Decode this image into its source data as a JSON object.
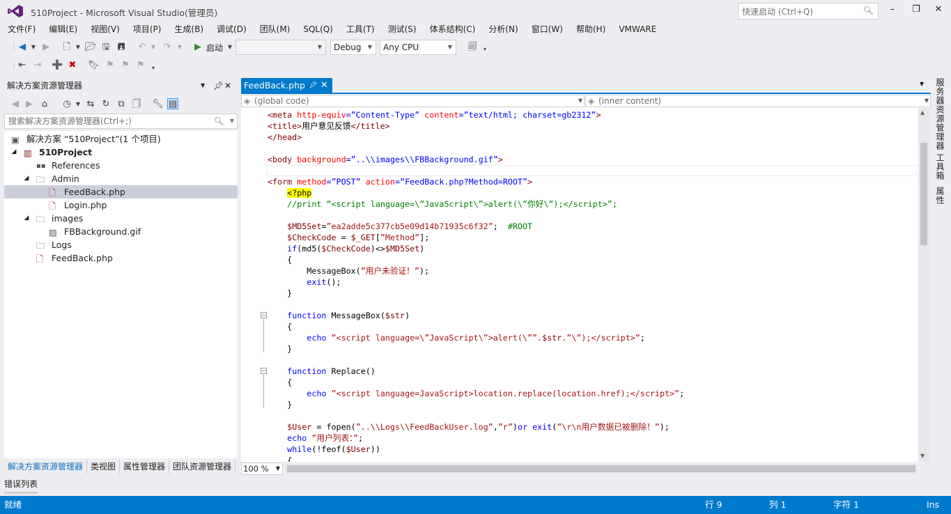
{
  "window": {
    "title": "510Project - Microsoft Visual Studio(管理员)",
    "quick_launch_placeholder": "快速启动 (Ctrl+Q)"
  },
  "menu": [
    "文件(F)",
    "编辑(E)",
    "视图(V)",
    "项目(P)",
    "生成(B)",
    "调试(D)",
    "团队(M)",
    "SQL(Q)",
    "工具(T)",
    "测试(S)",
    "体系结构(C)",
    "分析(N)",
    "窗口(W)",
    "帮助(H)",
    "VMWARE"
  ],
  "toolbar": {
    "start_label": "启动",
    "config": "Debug",
    "platform": "Any CPU"
  },
  "solution_explorer": {
    "title": "解决方案资源管理器",
    "search_placeholder": "搜索解决方案资源管理器(Ctrl+;)",
    "tree": [
      {
        "label": "解决方案 “510Project”(1 个项目)",
        "icon": "solution-icon"
      },
      {
        "label": "510Project",
        "icon": "php-project-icon"
      },
      {
        "label": "References",
        "icon": "references-icon"
      },
      {
        "label": "Admin",
        "icon": "folder-icon"
      },
      {
        "label": "FeedBack.php",
        "icon": "php-file-icon"
      },
      {
        "label": "Login.php",
        "icon": "php-file-icon"
      },
      {
        "label": "images",
        "icon": "folder-icon"
      },
      {
        "label": "FBBackground.gif",
        "icon": "image-file-icon"
      },
      {
        "label": "Logs",
        "icon": "folder-icon"
      },
      {
        "label": "FeedBack.php",
        "icon": "php-file-icon"
      }
    ],
    "bottom_tabs": [
      "解决方案资源管理器",
      "类视图",
      "属性管理器",
      "团队资源管理器"
    ]
  },
  "error_list_tab": "错误列表",
  "editor": {
    "tab_label": "FeedBack.php",
    "nav_left": "(global code)",
    "nav_right": "(inner content)",
    "zoom": "100 %"
  },
  "right_strip": [
    "服务器资源管理器",
    "工具箱",
    "属性"
  ],
  "status": {
    "ready": "就绪",
    "line": "行 9",
    "col": "列 1",
    "char": "字符 1",
    "mode": "Ins"
  },
  "colors": {
    "accent": "#007acc",
    "chrome": "#eeeef2",
    "selection": "#cccedb"
  }
}
